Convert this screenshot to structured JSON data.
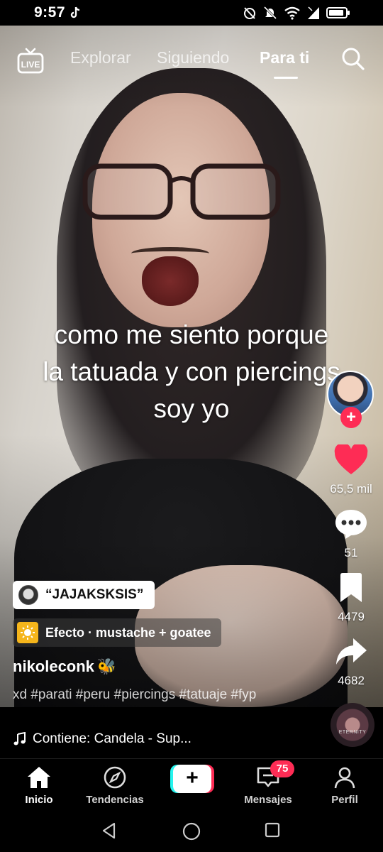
{
  "status_bar": {
    "time": "9:57",
    "icons": [
      "tiktok-icon",
      "alarm-off-icon",
      "mute-icon",
      "wifi-icon",
      "signal-icon",
      "battery-icon"
    ]
  },
  "top_nav": {
    "live_label": "LIVE",
    "tabs": [
      {
        "label": "Explorar",
        "active": false
      },
      {
        "label": "Siguiendo",
        "active": false
      },
      {
        "label": "Para ti",
        "active": true
      }
    ]
  },
  "video": {
    "caption": "como me siento porque la tatuada y con piercings soy yo"
  },
  "actions": {
    "likes": "65,5 mil",
    "comments": "51",
    "saves": "4479",
    "shares": "4682"
  },
  "sound_pill": "“JAJAKSKSIS”",
  "effect": "Efecto · mustache + goatee",
  "author": {
    "username": "nikoleconk",
    "emoji": "🐝"
  },
  "description": {
    "text": "xd",
    "hashtags": [
      "#parati",
      "#peru",
      "#piercings",
      "#tatuaje",
      "#fyp"
    ]
  },
  "music": {
    "text": "Contiene: Candela - Sup...",
    "disc_label": "ETERNITY"
  },
  "bottom_tabs": [
    {
      "label": "Inicio",
      "icon": "home-icon",
      "active": true
    },
    {
      "label": "Tendencias",
      "icon": "compass-icon",
      "active": false
    },
    {
      "label": "Mensajes",
      "icon": "inbox-icon",
      "active": false
    },
    {
      "label": "Perfil",
      "icon": "profile-icon",
      "active": false
    }
  ],
  "messages_badge": "75",
  "colors": {
    "accent_red": "#fe2c55",
    "accent_cyan": "#25f4ee",
    "effect_yellow": "#f5b51b"
  }
}
